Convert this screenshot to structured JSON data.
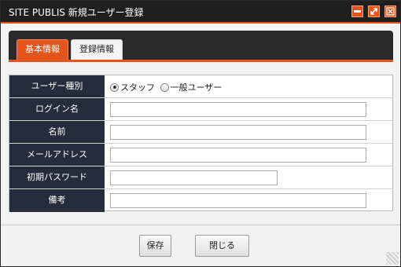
{
  "window": {
    "title": "SITE PUBLIS 新規ユーザー登録",
    "controls": {
      "minimize_icon": "minimize-icon",
      "maximize_icon": "maximize-icon",
      "close_icon": "close-icon"
    },
    "accent_color": "#e4541b"
  },
  "tabs": [
    {
      "label": "基本情報",
      "active": true
    },
    {
      "label": "登録情報",
      "active": false
    }
  ],
  "form": {
    "user_type": {
      "label": "ユーザー種別",
      "options": [
        {
          "label": "スタッフ",
          "checked": true
        },
        {
          "label": "一般ユーザー",
          "checked": false
        }
      ]
    },
    "login_name": {
      "label": "ログイン名",
      "value": ""
    },
    "name": {
      "label": "名前",
      "value": ""
    },
    "email": {
      "label": "メールアドレス",
      "value": ""
    },
    "initial_password": {
      "label": "初期パスワード",
      "value": ""
    },
    "notes": {
      "label": "備考",
      "value": ""
    }
  },
  "buttons": {
    "save": "保存",
    "close": "閉じる"
  }
}
